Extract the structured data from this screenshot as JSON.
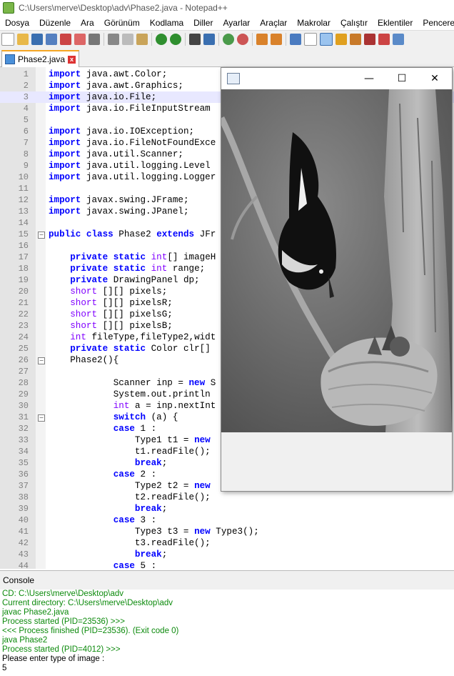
{
  "window": {
    "title": "C:\\Users\\merve\\Desktop\\adv\\Phase2.java - Notepad++"
  },
  "menu": [
    "Dosya",
    "Düzenle",
    "Ara",
    "Görünüm",
    "Kodlama",
    "Diller",
    "Ayarlar",
    "Araçlar",
    "Makrolar",
    "Çalıştır",
    "Eklentiler",
    "Pencereler"
  ],
  "tab": {
    "label": "Phase2.java",
    "close": "x"
  },
  "editor": {
    "lines": [
      {
        "n": "1",
        "code": "import java.awt.Color;"
      },
      {
        "n": "2",
        "code": "import java.awt.Graphics;"
      },
      {
        "n": "3",
        "code": "import java.io.File;"
      },
      {
        "n": "4",
        "code": "import java.io.FileInputStream"
      },
      {
        "n": "5",
        "code": ""
      },
      {
        "n": "6",
        "code": "import java.io.IOException;"
      },
      {
        "n": "7",
        "code": "import java.io.FileNotFoundExce"
      },
      {
        "n": "8",
        "code": "import java.util.Scanner;"
      },
      {
        "n": "9",
        "code": "import java.util.logging.Level"
      },
      {
        "n": "10",
        "code": "import java.util.logging.Logger"
      },
      {
        "n": "11",
        "code": ""
      },
      {
        "n": "12",
        "code": "import javax.swing.JFrame;"
      },
      {
        "n": "13",
        "code": "import javax.swing.JPanel;"
      },
      {
        "n": "14",
        "code": ""
      },
      {
        "n": "15",
        "code": "public class Phase2 extends JFr"
      },
      {
        "n": "16",
        "code": ""
      },
      {
        "n": "17",
        "code": "    private static int[] imageH"
      },
      {
        "n": "18",
        "code": "    private static int range;"
      },
      {
        "n": "19",
        "code": "    private DrawingPanel dp;"
      },
      {
        "n": "20",
        "code": "    short [][] pixels;"
      },
      {
        "n": "21",
        "code": "    short [][] pixelsR;"
      },
      {
        "n": "22",
        "code": "    short [][] pixelsG;"
      },
      {
        "n": "23",
        "code": "    short [][] pixelsB;"
      },
      {
        "n": "24",
        "code": "    int fileType,fileType2,widt"
      },
      {
        "n": "25",
        "code": "    private static Color clr[]"
      },
      {
        "n": "26",
        "code": "    Phase2(){"
      },
      {
        "n": "27",
        "code": ""
      },
      {
        "n": "28",
        "code": "            Scanner inp = new S"
      },
      {
        "n": "29",
        "code": "            System.out.println"
      },
      {
        "n": "30",
        "code": "            int a = inp.nextInt"
      },
      {
        "n": "31",
        "code": "            switch (a) {"
      },
      {
        "n": "32",
        "code": "            case 1 :"
      },
      {
        "n": "33",
        "code": "                Type1 t1 = new"
      },
      {
        "n": "34",
        "code": "                t1.readFile();"
      },
      {
        "n": "35",
        "code": "                break;"
      },
      {
        "n": "36",
        "code": "            case 2 :"
      },
      {
        "n": "37",
        "code": "                Type2 t2 = new"
      },
      {
        "n": "38",
        "code": "                t2.readFile();"
      },
      {
        "n": "39",
        "code": "                break;"
      },
      {
        "n": "40",
        "code": "            case 3 :"
      },
      {
        "n": "41",
        "code": "                Type3 t3 = new Type3();"
      },
      {
        "n": "42",
        "code": "                t3.readFile();"
      },
      {
        "n": "43",
        "code": "                break;"
      },
      {
        "n": "44",
        "code": "            case 5 :"
      }
    ]
  },
  "console": {
    "header": "Console",
    "lines": [
      {
        "text": "CD: C:\\Users\\merve\\Desktop\\adv",
        "color": "green"
      },
      {
        "text": "Current directory: C:\\Users\\merve\\Desktop\\adv",
        "color": "green"
      },
      {
        "text": "javac Phase2.java",
        "color": "green"
      },
      {
        "text": "Process started (PID=23536) >>>",
        "color": "green"
      },
      {
        "text": "<<< Process finished (PID=23536). (Exit code 0)",
        "color": "green"
      },
      {
        "text": "java Phase2",
        "color": "green"
      },
      {
        "text": "Process started (PID=4012) >>>",
        "color": "green"
      },
      {
        "text": "Please enter type of image :",
        "color": "black"
      },
      {
        "text": "5",
        "color": "black"
      }
    ]
  },
  "java_window": {
    "minimize": "—",
    "maximize": "☐",
    "close": "✕"
  }
}
